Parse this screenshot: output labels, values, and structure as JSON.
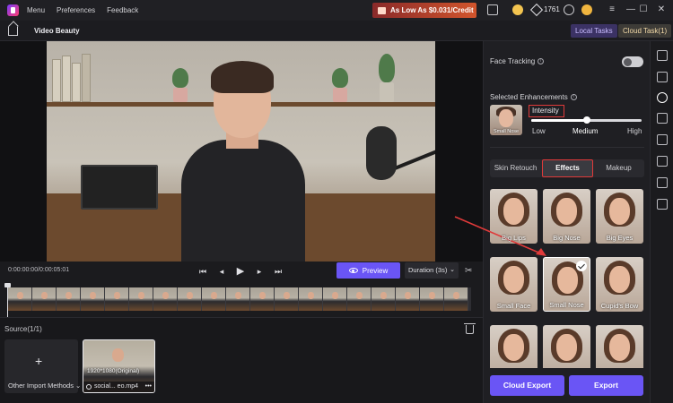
{
  "titlebar": {
    "menu": [
      "Menu",
      "Preferences",
      "Feedback"
    ],
    "promo": "As Low As $0.031/Credit",
    "credits": "1761",
    "window_buttons": [
      "—",
      "☐",
      "✕"
    ]
  },
  "header": {
    "title": "Video Beauty",
    "local_tasks": "Local Tasks",
    "cloud_tasks": "Cloud Task(1)"
  },
  "controls": {
    "timecode": "0:00:00:00/0:00:05:01",
    "preview": "Preview",
    "duration": "Duration (3s)"
  },
  "source": {
    "label": "Source(1/1)",
    "import_label": "Other Import Methods",
    "clip_resolution": "1920*1080(Original)",
    "clip_name": "social... eo.mp4",
    "clip_more": "•••"
  },
  "panel": {
    "face_tracking": "Face Tracking",
    "face_tracking_on": false,
    "selected_enhancements": "Selected Enhancements",
    "selected_thumb_label": "Small Nose",
    "intensity": "Intensity",
    "intensity_level": 0.5,
    "levels": {
      "low": "Low",
      "medium": "Medium",
      "high": "High"
    },
    "tabs": [
      "Skin Retouch",
      "Effects",
      "Makeup"
    ],
    "active_tab": "Effects",
    "effects": [
      {
        "label": "Big Lips"
      },
      {
        "label": "Big Nose"
      },
      {
        "label": "Big Eyes"
      },
      {
        "label": "Small Face"
      },
      {
        "label": "Small Nose",
        "selected": true
      },
      {
        "label": "Cupid's Bow"
      },
      {
        "label": ""
      },
      {
        "label": ""
      },
      {
        "label": ""
      }
    ],
    "cloud_export": "Cloud Export",
    "export": "Export"
  },
  "colors": {
    "accent": "#6a55f5",
    "highlight": "#e03a3a"
  }
}
